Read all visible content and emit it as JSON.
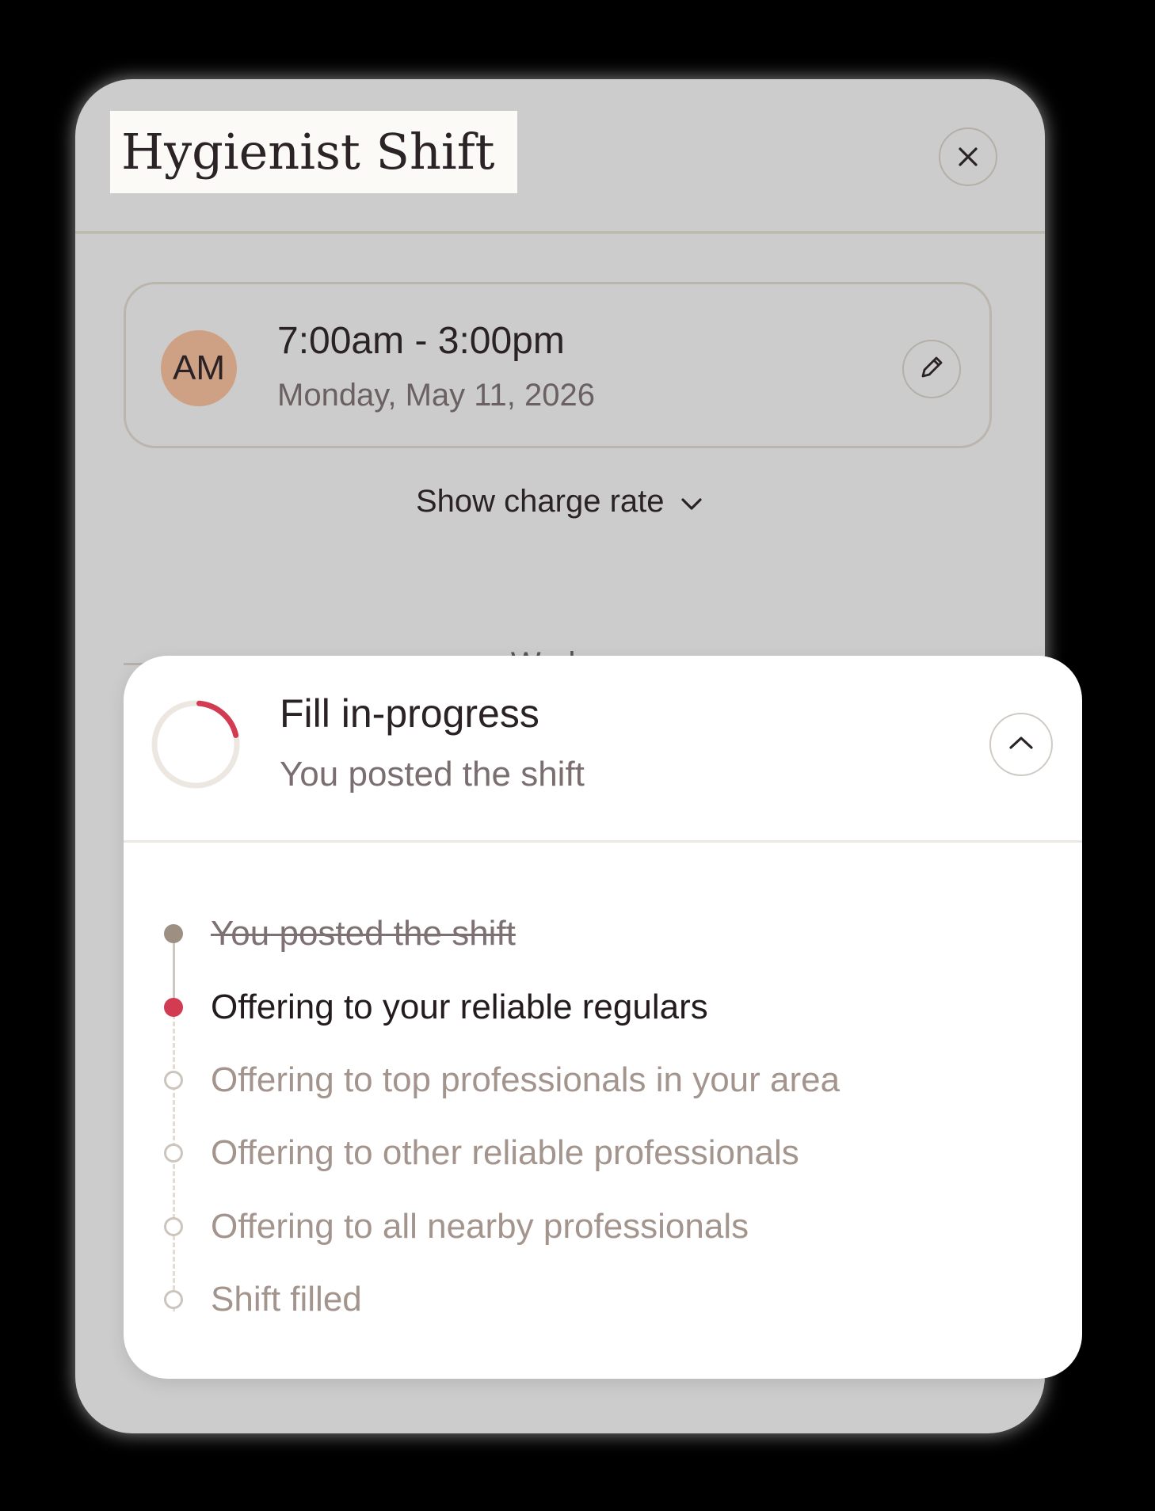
{
  "modal": {
    "title": "Hygienist Shift",
    "close_icon": "close-icon"
  },
  "shift": {
    "avatar_initials": "AM",
    "time_range": "7:00am - 3:00pm",
    "date": "Monday, May 11, 2026",
    "edit_icon": "pencil-icon"
  },
  "charge_rate": {
    "label": "Show charge rate",
    "icon": "chevron-down-icon"
  },
  "section": {
    "worker_label": "Worker"
  },
  "fill_status": {
    "title": "Fill in-progress",
    "subtitle": "You posted the shift",
    "progress_fraction": 0.2,
    "collapse_icon": "chevron-up-icon",
    "steps": [
      {
        "label": "You posted the shift",
        "state": "done"
      },
      {
        "label": "Offering to your reliable regulars",
        "state": "active"
      },
      {
        "label": "Offering to top professionals in your area",
        "state": "pending"
      },
      {
        "label": "Offering to other reliable professionals",
        "state": "pending"
      },
      {
        "label": "Offering to all nearby professionals",
        "state": "pending"
      },
      {
        "label": "Shift filled",
        "state": "pending"
      }
    ]
  },
  "colors": {
    "backdrop": "#000000",
    "modal_bg": "#cccccc",
    "accent_red": "#d23b52",
    "avatar_bg": "#cfa184",
    "card_bg": "#ffffff"
  }
}
